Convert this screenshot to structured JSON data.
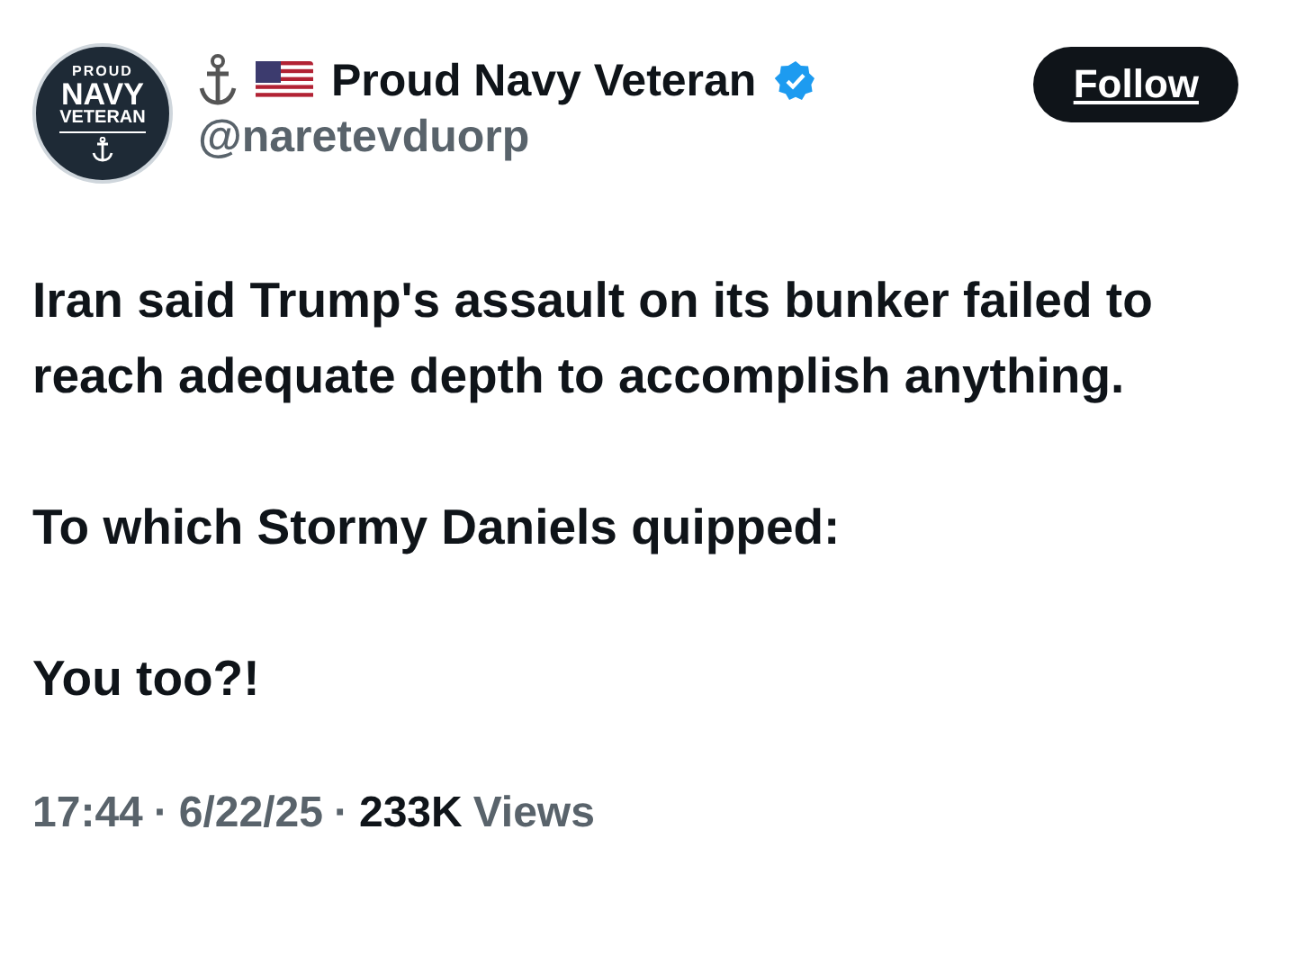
{
  "author": {
    "avatar_lines": [
      "PROUD",
      "NAVY",
      "VETERAN"
    ],
    "name": "Proud Navy Veteran",
    "verified": true,
    "handle": "@naretevduorp"
  },
  "follow_button": {
    "label": "Follow"
  },
  "paragraphs": [
    "Iran said Trump's assault on its bunker failed to reach adequate depth to accomplish anything.",
    "To which Stormy Daniels quipped:",
    "You too?!"
  ],
  "meta": {
    "time": "17:44",
    "separator_1": "·",
    "date": "6/22/25",
    "separator_2": "·",
    "views_count": "233K",
    "views_label": "Views"
  }
}
